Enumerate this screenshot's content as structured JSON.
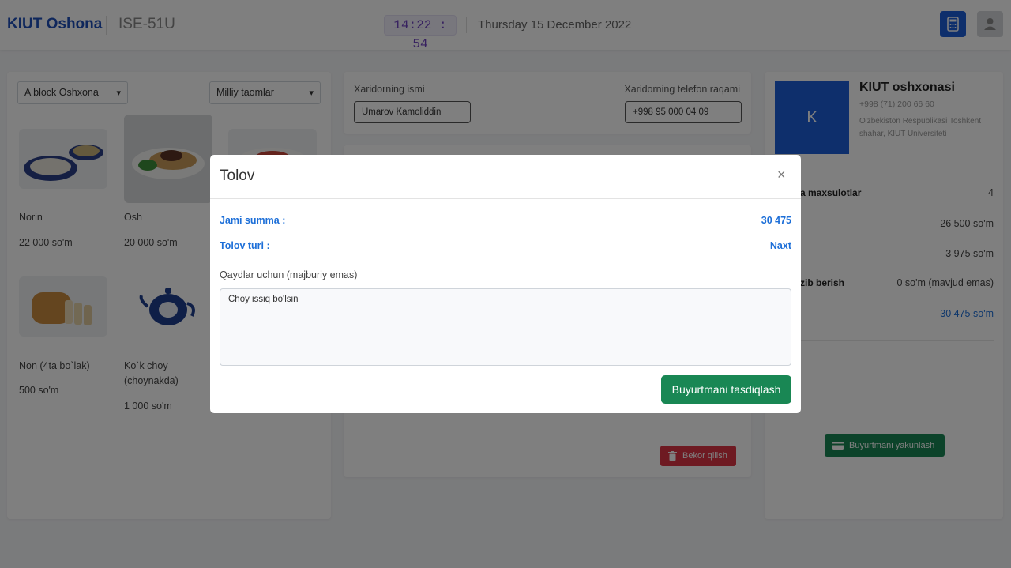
{
  "header": {
    "brand": "KIUT Oshona",
    "device": "ISE-51U",
    "time": "14:22 : 54",
    "date": "Thursday 15 December 2022",
    "calc_icon": "calculator-icon",
    "user_icon": "user-icon"
  },
  "filters": {
    "block": "A block Oshxona",
    "category": "Milliy taomlar"
  },
  "foods": [
    {
      "name": "Norin",
      "price": "22 000 so'm"
    },
    {
      "name": "Osh",
      "price": "20 000 so'm"
    },
    {
      "name": "Non (4ta bo`lak)",
      "price": "500 so'm"
    },
    {
      "name": "Ko`k choy (choynakda)",
      "price": "1 000 so'm"
    }
  ],
  "customer": {
    "name_label": "Xaridorning ismi",
    "name_value": "Umarov Kamoliddin",
    "phone_label": "Xaridorning telefon raqami",
    "phone_value": "+998 95 000 04 09"
  },
  "cancel_button": "Bekor qilish",
  "shop": {
    "logo_letter": "K",
    "name": "KIUT oshxonasi",
    "phone": "+998 (71) 200 66 60",
    "address": "O'zbekiston Respublikasi Toshkent shahar, KIUT Universiteti"
  },
  "summary": {
    "products_label": "a maxsulotlar",
    "products_count": "4",
    "subtotal": "26 500 so'm",
    "service": "3 975 so'm",
    "delivery_label": "zib berish",
    "delivery_value": "0 so'm (mavjud emas)",
    "total": "30 475 so'm"
  },
  "finish_button": "Buyurtmani yakunlash",
  "modal": {
    "title": "Tolov",
    "close": "×",
    "total_label": "Jami summa :",
    "total_value": "30 475",
    "payment_label": "Tolov turi :",
    "payment_value": "Naxt",
    "notes_label": "Qaydlar uchun (majburiy emas)",
    "notes_value": "Choy issiq bo'lsin",
    "confirm_button": "Buyurtmani tasdiqlash"
  },
  "colors": {
    "brand_blue": "#1f4fb8",
    "accent_blue": "#1d6fd8",
    "success_green": "#198754",
    "danger_red": "#dc3545"
  }
}
